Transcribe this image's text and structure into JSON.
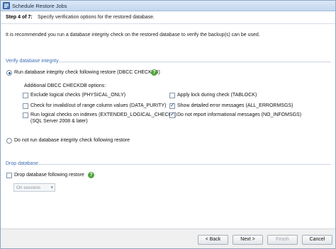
{
  "window": {
    "title": "Schedule Restore Jobs"
  },
  "header": {
    "step": "Step 4 of 7:",
    "description": "Specify verification options for the restored database."
  },
  "intro": "It is recommended you run a database integrity check on the restored database to verify the backup(s) can be used.",
  "verify": {
    "heading": "Verify database integrity",
    "run_label": "Run database integrity check following restore  (DBCC CHECKDB)",
    "run_selected": true,
    "additional_label": "Additional DBCC CHECKDB options:",
    "options_left": [
      {
        "label": "Exclude logical checks (PHYSICAL_ONLY)",
        "checked": false
      },
      {
        "label": "Check for invalid/out of range column values (DATA_PURITY)",
        "checked": false
      },
      {
        "label": "Run logical checks on indexes (EXTENDED_LOGICAL_CHECKS)",
        "label2": "(SQL Server 2008 & later)",
        "checked": false
      }
    ],
    "options_right": [
      {
        "label": "Apply lock during check (TABLOCK)",
        "checked": false
      },
      {
        "label": "Show detailed error messages (ALL_ERRORMSGS)",
        "checked": true
      },
      {
        "label": "Do not report informational messages (NO_INFOMSGS)",
        "checked": true
      }
    ],
    "no_run_label": "Do not run database integrity check following restore",
    "no_run_selected": false
  },
  "drop": {
    "heading": "Drop database",
    "drop_label": "Drop database following restore",
    "drop_checked": false,
    "condition_value": "On success"
  },
  "footer": {
    "back": "< Back",
    "next": "Next >",
    "finish": "Finish",
    "cancel": "Cancel"
  },
  "colors": {
    "accent": "#3d6fb3",
    "help": "#4da43c"
  },
  "icons": {
    "help": "help-icon",
    "app": "restore-app-icon"
  }
}
